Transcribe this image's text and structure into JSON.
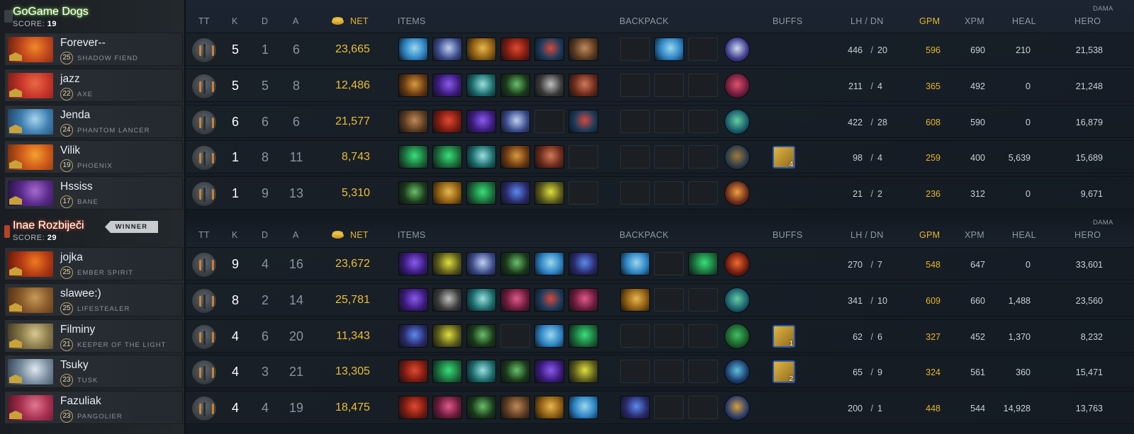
{
  "headers": {
    "tt": "TT",
    "k": "K",
    "d": "D",
    "a": "A",
    "net": "NET",
    "items": "ITEMS",
    "backpack": "BACKPACK",
    "buffs": "BUFFS",
    "lh_dn": "LH / DN",
    "gpm": "GPM",
    "xpm": "XPM",
    "heal": "HEAL",
    "damage": "DAMA",
    "hero": "HERO"
  },
  "teams": [
    {
      "name": "GoGame Dogs",
      "score_label": "SCORE:",
      "score": "19",
      "side": "radiant",
      "players": [
        {
          "name": "Forever--",
          "level": "25",
          "hero": "SHADOW FIEND",
          "kills": "5",
          "deaths": "1",
          "assists": "6",
          "net": "23,665",
          "lh": "446",
          "dn": "20",
          "gpm": "596",
          "xpm": "690",
          "heal": "210",
          "hero_dmg": "21,538",
          "buff": ""
        },
        {
          "name": "jazz",
          "level": "22",
          "hero": "AXE",
          "kills": "5",
          "deaths": "5",
          "assists": "8",
          "net": "12,486",
          "lh": "211",
          "dn": "4",
          "gpm": "365",
          "xpm": "492",
          "heal": "0",
          "hero_dmg": "21,248",
          "buff": ""
        },
        {
          "name": "Jenda",
          "level": "24",
          "hero": "PHANTOM LANCER",
          "kills": "6",
          "deaths": "6",
          "assists": "6",
          "net": "21,577",
          "lh": "422",
          "dn": "28",
          "gpm": "608",
          "xpm": "590",
          "heal": "0",
          "hero_dmg": "16,879",
          "buff": ""
        },
        {
          "name": "Vilik",
          "level": "19",
          "hero": "PHOENIX",
          "kills": "1",
          "deaths": "8",
          "assists": "11",
          "net": "8,743",
          "lh": "98",
          "dn": "4",
          "gpm": "259",
          "xpm": "400",
          "heal": "5,639",
          "hero_dmg": "15,689",
          "buff": "4"
        },
        {
          "name": "Hssiss",
          "level": "17",
          "hero": "BANE",
          "kills": "1",
          "deaths": "9",
          "assists": "13",
          "net": "5,310",
          "lh": "21",
          "dn": "2",
          "gpm": "236",
          "xpm": "312",
          "heal": "0",
          "hero_dmg": "9,671",
          "buff": ""
        }
      ]
    },
    {
      "name": "Inae Rozbiječi",
      "score_label": "SCORE:",
      "score": "29",
      "side": "dire",
      "winner": "WINNER",
      "players": [
        {
          "name": "jojka",
          "level": "25",
          "hero": "EMBER SPIRIT",
          "kills": "9",
          "deaths": "4",
          "assists": "16",
          "net": "23,672",
          "lh": "270",
          "dn": "7",
          "gpm": "548",
          "xpm": "647",
          "heal": "0",
          "hero_dmg": "33,601",
          "buff": ""
        },
        {
          "name": "slawee:)",
          "level": "25",
          "hero": "LIFESTEALER",
          "kills": "8",
          "deaths": "2",
          "assists": "14",
          "net": "25,781",
          "lh": "341",
          "dn": "10",
          "gpm": "609",
          "xpm": "660",
          "heal": "1,488",
          "hero_dmg": "23,560",
          "buff": ""
        },
        {
          "name": "Filminy",
          "level": "21",
          "hero": "KEEPER OF THE LIGHT",
          "kills": "4",
          "deaths": "6",
          "assists": "20",
          "net": "11,343",
          "lh": "62",
          "dn": "6",
          "gpm": "327",
          "xpm": "452",
          "heal": "1,370",
          "hero_dmg": "8,232",
          "buff": "1"
        },
        {
          "name": "Tsuky",
          "level": "23",
          "hero": "TUSK",
          "kills": "4",
          "deaths": "3",
          "assists": "21",
          "net": "13,305",
          "lh": "65",
          "dn": "9",
          "gpm": "324",
          "xpm": "561",
          "heal": "360",
          "hero_dmg": "15,471",
          "buff": "2"
        },
        {
          "name": "Fazuliak",
          "level": "23",
          "hero": "PANGOLIER",
          "kills": "4",
          "deaths": "4",
          "assists": "19",
          "net": "18,475",
          "lh": "200",
          "dn": "1",
          "gpm": "448",
          "xpm": "544",
          "heal": "14,928",
          "hero_dmg": "13,763",
          "buff": ""
        }
      ]
    }
  ],
  "colors": {
    "gold": "#ecbf32",
    "radiant_glow": "#7cd34b",
    "dire_glow": "#d34b2a"
  }
}
